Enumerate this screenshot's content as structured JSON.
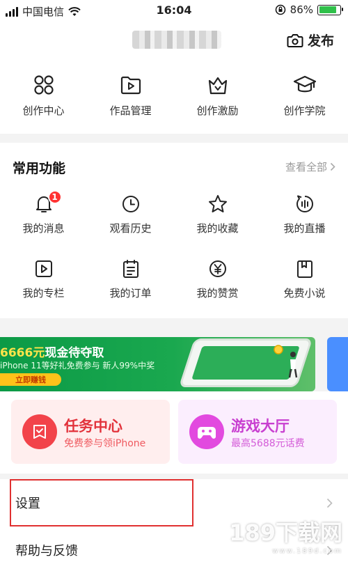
{
  "status_bar": {
    "carrier": "中国电信",
    "time": "16:04",
    "battery": "86%",
    "battery_level": 0.86
  },
  "header": {
    "publish_label": "发布"
  },
  "creator_menu": [
    {
      "label": "创作中心",
      "icon": "grid-icon"
    },
    {
      "label": "作品管理",
      "icon": "folder-play-icon"
    },
    {
      "label": "创作激励",
      "icon": "crown-icon"
    },
    {
      "label": "创作学院",
      "icon": "graduation-cap-icon"
    }
  ],
  "common_functions": {
    "title": "常用功能",
    "see_all": "查看全部",
    "items": [
      {
        "label": "我的消息",
        "icon": "bell-icon",
        "badge": "1"
      },
      {
        "label": "观看历史",
        "icon": "clock-icon"
      },
      {
        "label": "我的收藏",
        "icon": "star-icon"
      },
      {
        "label": "我的直播",
        "icon": "live-icon"
      },
      {
        "label": "我的专栏",
        "icon": "play-square-icon"
      },
      {
        "label": "我的订单",
        "icon": "order-icon"
      },
      {
        "label": "我的赞赏",
        "icon": "yen-coin-icon"
      },
      {
        "label": "免费小说",
        "icon": "book-icon"
      }
    ]
  },
  "banner": {
    "title_amount": "6666元",
    "title_rest": "现金待夺取",
    "subtitle": "iPhone 11等好礼免费参与  新人99%中奖",
    "button": "立即赚钱"
  },
  "cards": [
    {
      "title": "任务中心",
      "subtitle": "免费参与领iPhone",
      "icon": "task-icon",
      "color": "#f2434a"
    },
    {
      "title": "游戏大厅",
      "subtitle": "最高5688元话费",
      "icon": "gamepad-icon",
      "color": "#e24adf"
    }
  ],
  "list": [
    {
      "label": "设置"
    },
    {
      "label": "帮助与反馈"
    }
  ],
  "watermark": {
    "main": "189下载网",
    "sub": "www.189d.com"
  }
}
